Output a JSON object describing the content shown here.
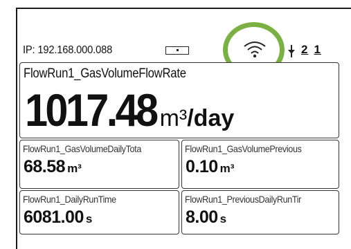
{
  "status": {
    "ip": "IP: 192.168.000.088",
    "channels": [
      "2",
      "1"
    ]
  },
  "icons": {
    "battery": "battery-icon",
    "wifi": "wifi-icon",
    "plug": "power-plug-icon",
    "highlight_color": "#7bb043"
  },
  "main": {
    "label": "FlowRun1_GasVolumeFlowRate",
    "value": "1017.48",
    "unit_m": "m³",
    "unit_rest": "/day"
  },
  "panels": [
    {
      "label": "FlowRun1_GasVolumeDailyTota",
      "value": "68.58",
      "unit": "m³"
    },
    {
      "label": "FlowRun1_GasVolumePrevious",
      "value": "0.10",
      "unit": "m³"
    },
    {
      "label": "FlowRun1_DailyRunTime",
      "value": "6081.00",
      "unit": "s"
    },
    {
      "label": "FlowRun1_PreviousDailyRunTir",
      "value": "8.00",
      "unit": "s"
    }
  ]
}
